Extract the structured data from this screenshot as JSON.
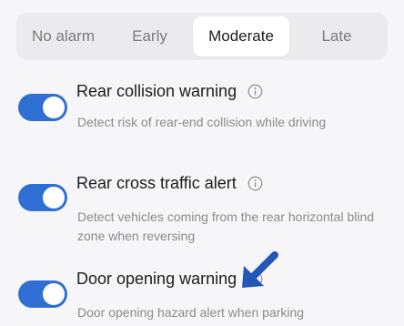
{
  "alarm_timing": {
    "options": [
      "No alarm",
      "Early",
      "Moderate",
      "Late"
    ],
    "selected": "Moderate"
  },
  "settings": [
    {
      "title": "Rear collision warning",
      "description": "Detect risk of rear-end collision while driving",
      "enabled": true
    },
    {
      "title": "Rear cross traffic alert",
      "description": "Detect vehicles coming from the rear horizontal blind zone when reversing",
      "enabled": true
    },
    {
      "title": "Door opening warning",
      "description": "Door opening hazard alert when parking",
      "enabled": true
    }
  ],
  "icons": {
    "info": "info-circle-icon",
    "pointer": "arrow-pointer-icon"
  },
  "colors": {
    "toggle_on": "#2f6fd3",
    "arrow": "#2456b8"
  }
}
